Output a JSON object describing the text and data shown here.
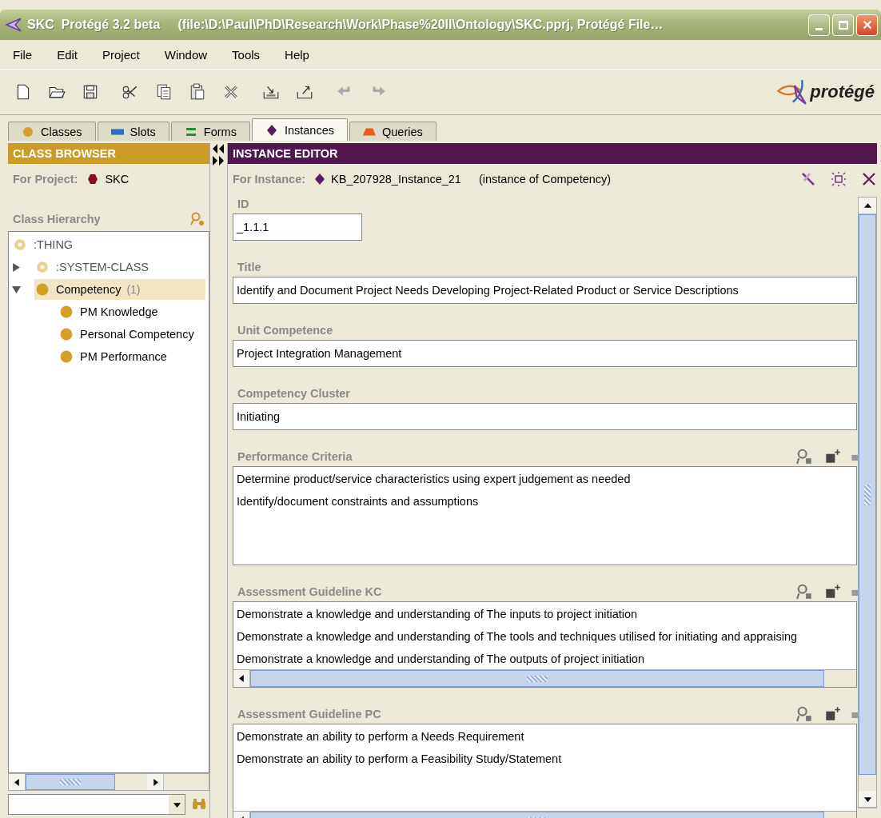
{
  "window": {
    "title": "SKC  Protégé 3.2 beta     (file:\\D:\\Paul\\PhD\\Research\\Work\\Phase%20II\\Ontology\\SKC.pprj, Protégé File…"
  },
  "menu": [
    {
      "label": "File"
    },
    {
      "label": "Edit"
    },
    {
      "label": "Project"
    },
    {
      "label": "Window"
    },
    {
      "label": "Tools"
    },
    {
      "label": "Help"
    }
  ],
  "logo": {
    "text": "protégé"
  },
  "tabs": [
    {
      "label": "Classes",
      "kind": "classes",
      "selected": false
    },
    {
      "label": "Slots",
      "kind": "slots",
      "selected": false
    },
    {
      "label": "Forms",
      "kind": "forms",
      "selected": false
    },
    {
      "label": "Instances",
      "kind": "instances",
      "selected": true
    },
    {
      "label": "Queries",
      "kind": "queries",
      "selected": false
    }
  ],
  "class_browser": {
    "header": "CLASS BROWSER",
    "project_label": "For Project:",
    "project": "SKC",
    "hierarchy_label": "Class Hierarchy",
    "tree": [
      {
        "label": ":THING",
        "kind": "system",
        "selected": false,
        "children": [
          {
            "label": ":SYSTEM-CLASS",
            "kind": "system",
            "selected": false,
            "expanded": false
          },
          {
            "label": "Competency",
            "kind": "class",
            "count": "(1)",
            "selected": true,
            "expanded": true,
            "children": [
              {
                "label": "PM Knowledge",
                "kind": "class",
                "selected": false
              },
              {
                "label": "Personal Competency",
                "kind": "class",
                "selected": false
              },
              {
                "label": "PM Performance",
                "kind": "class",
                "selected": false
              }
            ]
          }
        ]
      }
    ]
  },
  "instance_editor": {
    "header": "INSTANCE EDITOR",
    "instance_label": "For Instance:",
    "instance": "KB_207928_Instance_21",
    "instance_type": "(instance of Competency)",
    "slots": [
      {
        "kind": "short",
        "label": "ID",
        "value": "_1.1.1"
      },
      {
        "kind": "field",
        "label": "Title",
        "value": "Identify and Document Project Needs Developing Project-Related Product or Service Descriptions"
      },
      {
        "kind": "field",
        "label": "Unit Competence",
        "value": "Project Integration Management"
      },
      {
        "kind": "field",
        "label": "Competency Cluster",
        "value": "Initiating"
      },
      {
        "kind": "list",
        "label": "Performance Criteria",
        "hscroll": false,
        "items": [
          "Determine product/service characteristics using expert judgement as needed",
          "Identify/document constraints and assumptions"
        ]
      },
      {
        "kind": "list",
        "label": "Assessment Guideline KC",
        "hscroll": true,
        "items": [
          "Demonstrate a knowledge and understanding of The inputs to project initiation",
          "Demonstrate a knowledge and understanding of The tools and techniques utilised for initiating and appraising",
          "Demonstrate a knowledge and understanding of The outputs of project initiation"
        ]
      },
      {
        "kind": "list",
        "label": "Assessment Guideline PC",
        "hscroll": true,
        "items": [
          "Demonstrate an ability to perform a Needs Requirement",
          "Demonstrate an ability to perform a Feasibility Study/Statement"
        ]
      }
    ]
  }
}
